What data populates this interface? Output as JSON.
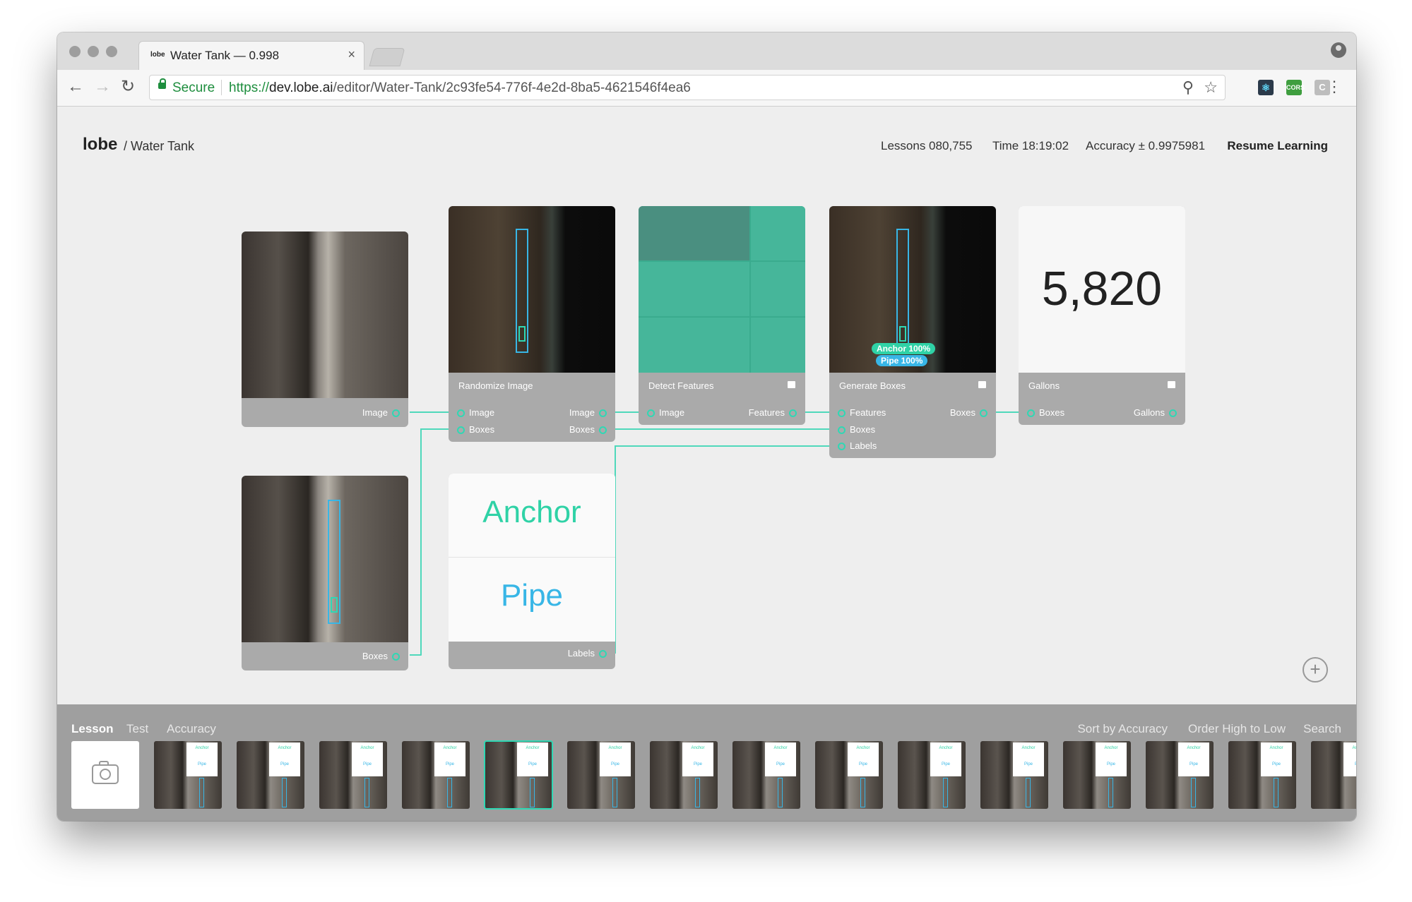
{
  "browser": {
    "tab_title": "Water Tank — 0.998",
    "tab_favicon": "lobe",
    "tab_close": "×",
    "secure_label": "Secure",
    "url_protocol": "https://",
    "url_host": "dev.lobe.ai",
    "url_path": "/editor/Water-Tank/2c93fe54-776f-4e2d-8ba5-4621546f4ea6",
    "extensions": [
      "react-devtools-icon",
      "cors-icon",
      "c-icon"
    ],
    "extension_labels": [
      "⚛",
      "CORS",
      "C"
    ]
  },
  "header": {
    "brand": "lobe",
    "crumb": "/ Water Tank",
    "lessons": "Lessons 080,755",
    "time": "Time 18:19:02",
    "accuracy": "Accuracy  ± 0.9975981",
    "resume": "Resume Learning"
  },
  "nodes": {
    "image_input": {
      "out": "Image"
    },
    "boxes_input": {
      "out": "Boxes"
    },
    "randomize": {
      "title": "Randomize Image",
      "in": [
        "Image",
        "Boxes"
      ],
      "out": [
        "Image",
        "Boxes"
      ]
    },
    "detect": {
      "title": "Detect Features",
      "in": [
        "Image"
      ],
      "out": [
        "Features"
      ]
    },
    "generate": {
      "title": "Generate Boxes",
      "in": [
        "Features",
        "Boxes",
        "Labels"
      ],
      "out": [
        "Boxes"
      ],
      "pills": [
        "Anchor 100%",
        "Pipe 100%"
      ]
    },
    "gallons": {
      "title": "Gallons",
      "value": "5,820",
      "in": [
        "Boxes"
      ],
      "out": [
        "Gallons"
      ]
    },
    "labels": {
      "anchor": "Anchor",
      "pipe": "Pipe",
      "out": "Labels"
    }
  },
  "bottom": {
    "tabs": [
      "Lesson",
      "Test",
      "Accuracy"
    ],
    "active_tab": "Lesson",
    "sort": "Sort by Accuracy",
    "order": "Order High to Low",
    "search": "Search",
    "thumb_anchor": "Anchor",
    "thumb_pipe": "Pipe",
    "selected_thumb_index": 4
  },
  "colors": {
    "accent": "#2fd8b4",
    "anchor": "#2fd2a6",
    "pipe": "#38b6e6"
  }
}
